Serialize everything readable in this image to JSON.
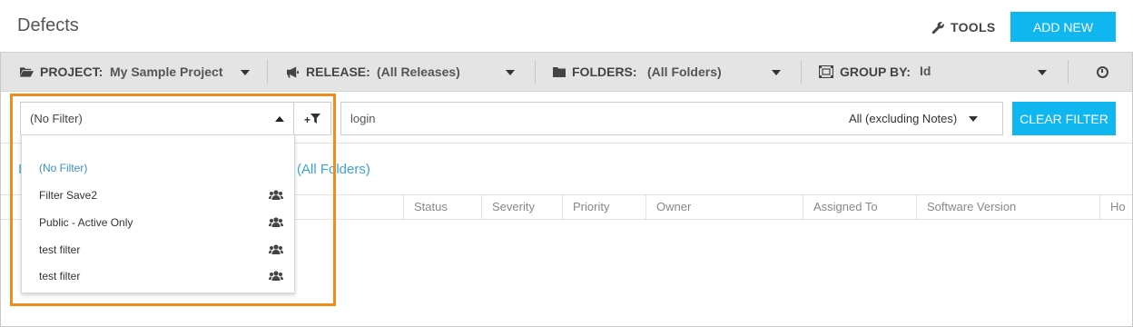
{
  "header": {
    "title": "Defects",
    "tools_label": "TOOLS",
    "add_new_label": "ADD NEW"
  },
  "toolbar": {
    "project": {
      "label": "PROJECT:",
      "value": "My Sample Project"
    },
    "release": {
      "label": "RELEASE:",
      "value": "(All Releases)"
    },
    "folders": {
      "label": "FOLDERS:",
      "value": "(All Folders)"
    },
    "group_by": {
      "label": "GROUP BY:",
      "value": "Id"
    }
  },
  "filter": {
    "selected": "(No Filter)",
    "add_filter_label": "+",
    "search_value": "login",
    "search_scope": "All (excluding Notes)",
    "clear_label": "CLEAR FILTER"
  },
  "dropdown": {
    "items": [
      {
        "label": "(No Filter)",
        "shared": false,
        "selected": true
      },
      {
        "label": "Filter Save2",
        "shared": true,
        "selected": false
      },
      {
        "label": "Public - Active Only",
        "shared": true,
        "selected": false
      },
      {
        "label": "test filter",
        "shared": true,
        "selected": false
      },
      {
        "label": "test filter",
        "shared": true,
        "selected": false
      }
    ]
  },
  "content": {
    "breadcrumb_stub": "I",
    "folder_label": "(All Folders)"
  },
  "table": {
    "columns": [
      "Status",
      "Severity",
      "Priority",
      "Owner",
      "Assigned To",
      "Software Version",
      "Ho"
    ]
  },
  "colors": {
    "accent": "#0fb6f0",
    "highlight": "#f28a1c",
    "link": "#3aa3d6"
  }
}
